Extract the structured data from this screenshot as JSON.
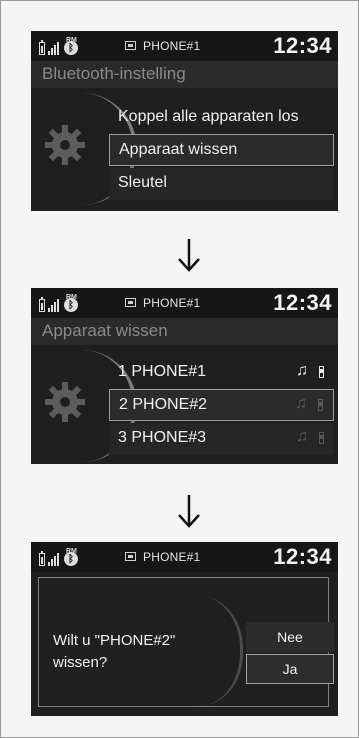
{
  "screens": [
    {
      "status": {
        "phone_name": "PHONE#1",
        "time": "12:34",
        "rm_label": "RM"
      },
      "title": "Bluetooth-instelling",
      "items": [
        {
          "label": "Koppel alle apparaten los"
        },
        {
          "label": "Apparaat wissen",
          "selected": true
        },
        {
          "label": "Sleutel"
        }
      ]
    },
    {
      "status": {
        "phone_name": "PHONE#1",
        "time": "12:34",
        "rm_label": "RM"
      },
      "title": "Apparaat wissen",
      "items": [
        {
          "label": "1 PHONE#1"
        },
        {
          "label": "2 PHONE#2",
          "selected": true
        },
        {
          "label": "3 PHONE#3"
        }
      ]
    },
    {
      "status": {
        "phone_name": "PHONE#1",
        "time": "12:34",
        "rm_label": "RM"
      },
      "dialog": {
        "question": "Wilt u \"PHONE#2\" wissen?",
        "no_label": "Nee",
        "yes_label": "Ja"
      }
    }
  ],
  "icons": {
    "flow_arrow": "down-arrow-icon",
    "battery": "battery-icon",
    "signal": "signal-strength-icon",
    "bluetooth": "bluetooth-icon",
    "phone": "phone-icon",
    "music": "music-note-icon",
    "settings": "gear-icon"
  },
  "colors": {
    "screen_bg": "#1f1f1f",
    "text": "#f0f0f0",
    "dim_title": "#8a8a8a"
  }
}
